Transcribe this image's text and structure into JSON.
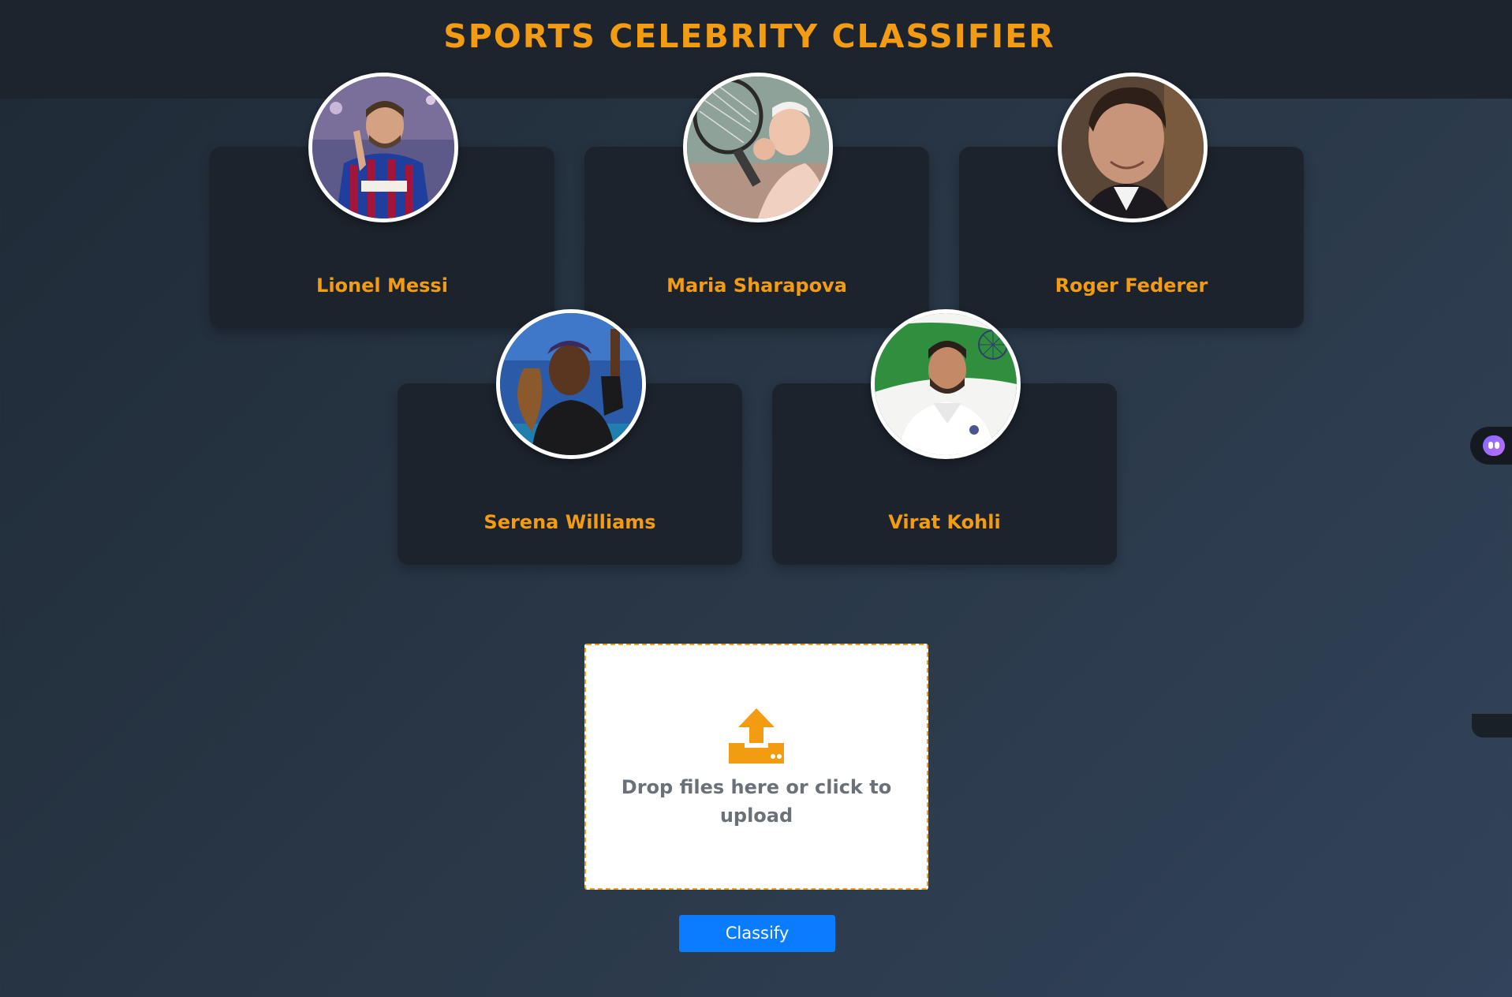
{
  "header": {
    "title": "SPORTS CELEBRITY CLASSIFIER"
  },
  "celebrities": [
    {
      "name": "Lionel Messi",
      "icon": "lionel-messi-photo"
    },
    {
      "name": "Maria Sharapova",
      "icon": "maria-sharapova-photo"
    },
    {
      "name": "Roger Federer",
      "icon": "roger-federer-photo"
    },
    {
      "name": "Serena Williams",
      "icon": "serena-williams-photo"
    },
    {
      "name": "Virat Kohli",
      "icon": "virat-kohli-photo"
    }
  ],
  "dropzone": {
    "text": "Drop files here or click to upload",
    "icon": "upload-icon"
  },
  "actions": {
    "classify_label": "Classify"
  },
  "colors": {
    "accent": "#f39c12",
    "button": "#0a7cff",
    "card": "#1c232c",
    "header": "#1d242d"
  }
}
